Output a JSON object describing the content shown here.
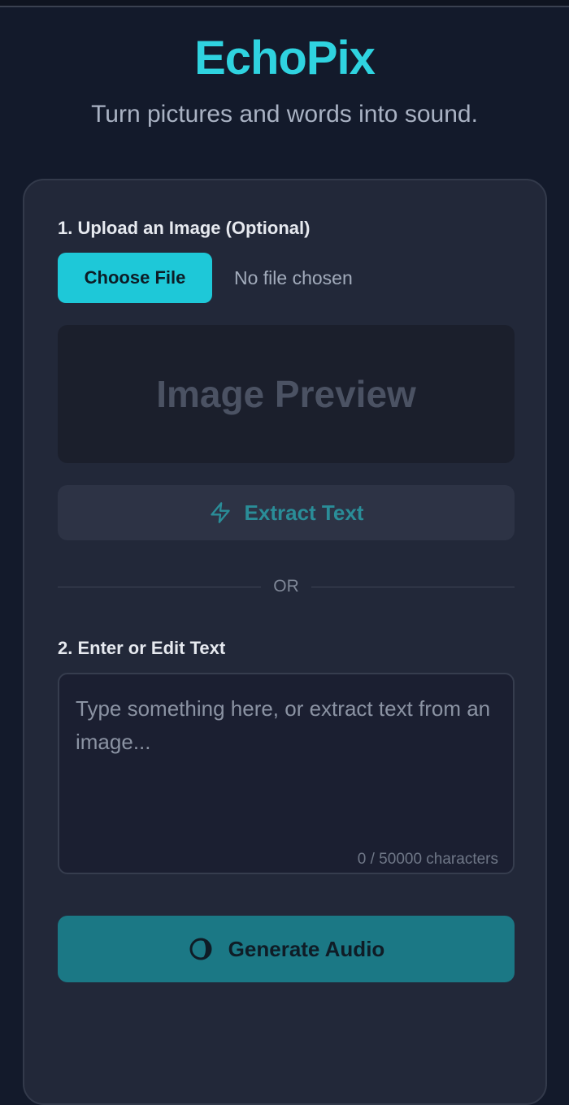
{
  "app": {
    "title": "EchoPix",
    "subtitle": "Turn pictures and words into sound."
  },
  "upload": {
    "label": "1. Upload an Image (Optional)",
    "choose_button": "Choose File",
    "file_status": "No file chosen",
    "preview_placeholder": "Image Preview"
  },
  "extract": {
    "icon": "lightning-icon",
    "label": "Extract Text"
  },
  "divider": {
    "text": "OR"
  },
  "text_input": {
    "label": "2. Enter or Edit Text",
    "value": "",
    "placeholder": "Type something here, or extract text from an image...",
    "char_count": "0 / 50000 characters"
  },
  "generate": {
    "icon": "loading-spinner-icon",
    "label": "Generate Audio"
  },
  "colors": {
    "background": "#131a2b",
    "accent": "#2fd3e0",
    "card": "#222839",
    "choose_button": "#1ec8d8",
    "generate_button": "#1b7885"
  }
}
